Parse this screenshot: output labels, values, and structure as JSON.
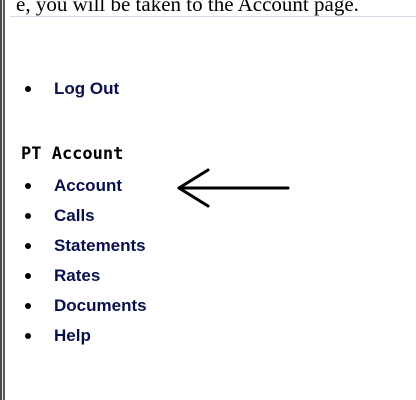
{
  "page": {
    "top_text": "e, you will be taken to the Account page."
  },
  "menu": {
    "log_out": "Log Out"
  },
  "pt_account": {
    "heading": "PT Account",
    "items": [
      "Account",
      "Calls",
      "Statements",
      "Rates",
      "Documents",
      "Help"
    ]
  },
  "annotation": {
    "arrow_icon": "left-arrow-icon"
  }
}
